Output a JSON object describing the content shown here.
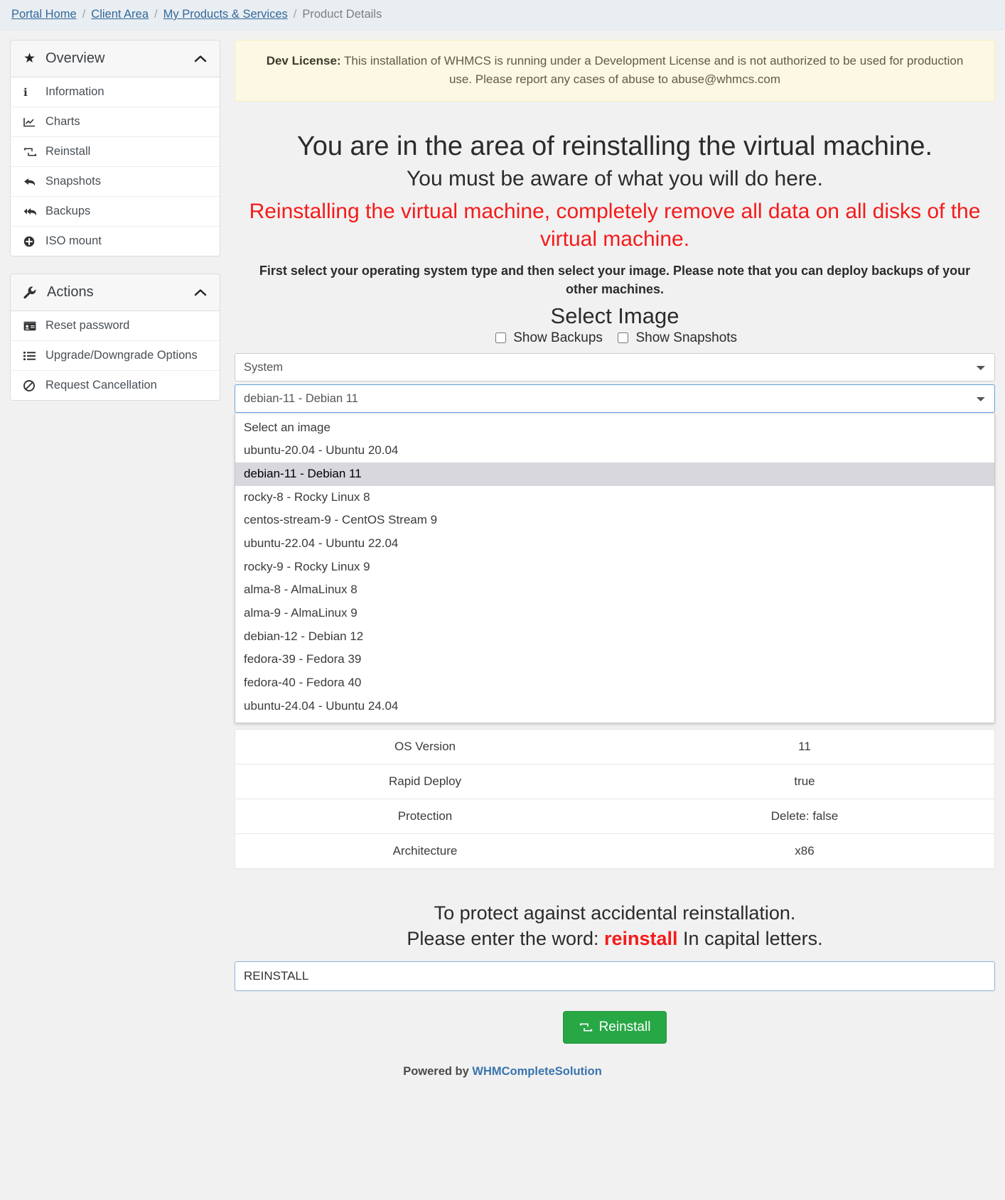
{
  "breadcrumb": {
    "items": [
      {
        "label": "Portal Home",
        "active": false
      },
      {
        "label": "Client Area",
        "active": false
      },
      {
        "label": "My Products & Services",
        "active": false
      },
      {
        "label": "Product Details",
        "active": true
      }
    ],
    "separator": "/"
  },
  "sidebar": {
    "panels": [
      {
        "title": "Overview",
        "icon": "star-icon",
        "collapse_icon": "chevron-up-icon",
        "items": [
          {
            "label": "Information",
            "icon": "info-icon"
          },
          {
            "label": "Charts",
            "icon": "chart-line-icon"
          },
          {
            "label": "Reinstall",
            "icon": "retweet-icon"
          },
          {
            "label": "Snapshots",
            "icon": "reply-icon"
          },
          {
            "label": "Backups",
            "icon": "reply-all-icon"
          },
          {
            "label": "ISO mount",
            "icon": "plus-circle-icon"
          }
        ]
      },
      {
        "title": "Actions",
        "icon": "wrench-icon",
        "collapse_icon": "chevron-up-icon",
        "items": [
          {
            "label": "Reset password",
            "icon": "id-card-icon"
          },
          {
            "label": "Upgrade/Downgrade Options",
            "icon": "list-icon"
          },
          {
            "label": "Request Cancellation",
            "icon": "ban-icon"
          }
        ]
      }
    ]
  },
  "dev_license": {
    "label": "Dev License:",
    "text": "This installation of WHMCS is running under a Development License and is not authorized to be used for production use. Please report any cases of abuse to abuse@whmcs.com"
  },
  "main": {
    "heading": "You are in the area of reinstalling the virtual machine.",
    "subheading": "You must be aware of what you will do here.",
    "warning": "Reinstalling the virtual machine, completely remove all data on all disks of the virtual machine.",
    "note": "First select your operating system type and then select your image. Please note that you can deploy backups of your other machines.",
    "select_image_heading": "Select Image",
    "checkboxes": [
      {
        "label": "Show Backups",
        "checked": false
      },
      {
        "label": "Show Snapshots",
        "checked": false
      }
    ],
    "os_type_select": {
      "value": "System",
      "options": [
        "System"
      ]
    },
    "image_select": {
      "value": "debian-11 - Debian 11",
      "open": true,
      "options": [
        "Select an image",
        "ubuntu-20.04 - Ubuntu 20.04",
        "debian-11 - Debian 11",
        "rocky-8 - Rocky Linux 8",
        "centos-stream-9 - CentOS Stream 9",
        "ubuntu-22.04 - Ubuntu 22.04",
        "rocky-9 - Rocky Linux 9",
        "alma-8 - AlmaLinux 8",
        "alma-9 - AlmaLinux 9",
        "debian-12 - Debian 12",
        "fedora-39 - Fedora 39",
        "fedora-40 - Fedora 40",
        "ubuntu-24.04 - Ubuntu 24.04"
      ],
      "selected_option": "debian-11 - Debian 11"
    },
    "info_table": {
      "rows": [
        {
          "label": "OS Version",
          "value": "11"
        },
        {
          "label": "Rapid Deploy",
          "value": "true"
        },
        {
          "label": "Protection",
          "value": "Delete: false"
        },
        {
          "label": "Architecture",
          "value": "x86"
        }
      ]
    },
    "confirm": {
      "line1": "To protect against accidental reinstallation.",
      "line2_prefix": "Please enter the word: ",
      "line2_word": "reinstall",
      "line2_suffix": " In capital letters.",
      "input_value": "REINSTALL",
      "input_placeholder": ""
    },
    "reinstall_button": {
      "label": "Reinstall",
      "icon": "retweet-icon",
      "color": "#28a745"
    }
  },
  "footer": {
    "powered_by": "Powered by ",
    "brand": "WHMCompleteSolution"
  },
  "colors": {
    "link": "#32689a",
    "danger": "#f51b1b",
    "success": "#28a745",
    "warning_bg": "#fcf8e3"
  }
}
